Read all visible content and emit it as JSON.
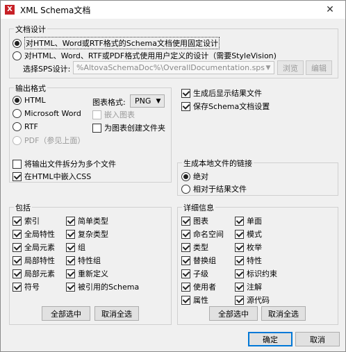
{
  "window": {
    "title": "XML Schema文档",
    "app_icon_glyph": "X",
    "close_glyph": "✕"
  },
  "design": {
    "title": "文档设计",
    "fixed_label": "对HTML、Word或RTF格式的Schema文档使用固定设计",
    "custom_label": "对HTML、Word、RTF或PDF格式使用用户定义的设计（需要StyleVision)",
    "sps_label": "选择SPS设计:",
    "sps_value": "%AltovaSchemaDoc%\\OverallDocumentation.sps",
    "browse": "浏览",
    "edit": "编辑"
  },
  "output": {
    "title": "输出格式",
    "html": "HTML",
    "word": "Microsoft Word",
    "rtf": "RTF",
    "pdf": "PDF（参见上面）",
    "chart_format_label": "图表格式:",
    "chart_format_value": "PNG",
    "embed_charts": "嵌入图表",
    "create_folder": "为图表创建文件夹",
    "split_files": "将输出文件拆分为多个文件",
    "embed_css": "在HTML中嵌入CSS"
  },
  "options": {
    "show_result": "生成后显示结果文件",
    "save_settings": "保存Schema文档设置"
  },
  "links": {
    "title": "生成本地文件的链接",
    "absolute": "绝对",
    "relative": "相对于结果文件"
  },
  "include": {
    "title": "包括",
    "col1": [
      "索引",
      "全局特性",
      "全局元素",
      "局部特性",
      "局部元素",
      "符号"
    ],
    "col2": [
      "简单类型",
      "复杂类型",
      "组",
      "特性组",
      "重新定义",
      "被引用的Schema"
    ],
    "select_all": "全部选中",
    "deselect_all": "取消全选"
  },
  "details": {
    "title": "详细信息",
    "col1": [
      "图表",
      "命名空间",
      "类型",
      "替换组",
      "子级",
      "使用者",
      "属性"
    ],
    "col2": [
      "单面",
      "模式",
      "枚举",
      "特性",
      "标识约束",
      "注解",
      "源代码"
    ],
    "select_all": "全部选中",
    "deselect_all": "取消全选"
  },
  "footer": {
    "ok": "确定",
    "cancel": "取消"
  }
}
